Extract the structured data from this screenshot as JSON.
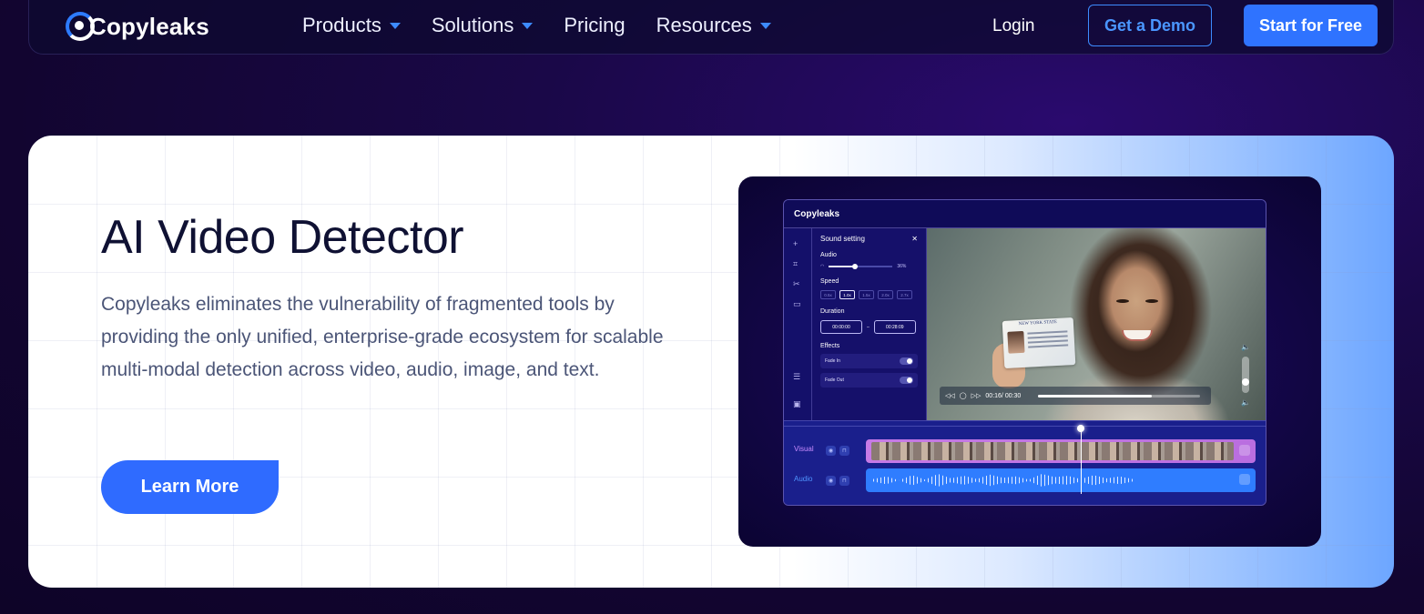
{
  "nav": {
    "logo_text": "Copyleaks",
    "menu": [
      {
        "label": "Products",
        "dropdown": true
      },
      {
        "label": "Solutions",
        "dropdown": true
      },
      {
        "label": "Pricing",
        "dropdown": false
      },
      {
        "label": "Resources",
        "dropdown": true
      }
    ],
    "login": "Login",
    "demo_button": "Get a Demo",
    "start_button": "Start for Free"
  },
  "hero": {
    "title": "AI Video Detector",
    "description": "Copyleaks eliminates the vulnerability of fragmented tools by providing the only unified, enterprise-grade ecosystem for scalable multi-modal detection across video, audio, image, and text.",
    "cta": "Learn More"
  },
  "mockup": {
    "app_logo": "Copyleaks",
    "panel_title": "Sound setting",
    "audio_label": "Audio",
    "audio_value": "36%",
    "speed_label": "Speed",
    "speed_options": [
      "0.5x",
      "1.0x",
      "1.5x",
      "2.0x",
      "2.7x"
    ],
    "duration_label": "Duration",
    "duration_start": "00:00:00",
    "duration_end": "00:28:09",
    "effects_label": "Effects",
    "effects": [
      "Fade In",
      "Fade Out"
    ],
    "id_card_title": "NEW YORK STATE",
    "time_display": "00:16/ 00:30",
    "visual_label": "Visual",
    "audio_track_label": "Audio"
  },
  "colors": {
    "accent": "#2f73ff",
    "page_bg": "#120530",
    "title_text": "#0f1133",
    "body_text": "#4b5577",
    "visual_track": "#c67ae6",
    "audio_track": "#2f7dff"
  }
}
